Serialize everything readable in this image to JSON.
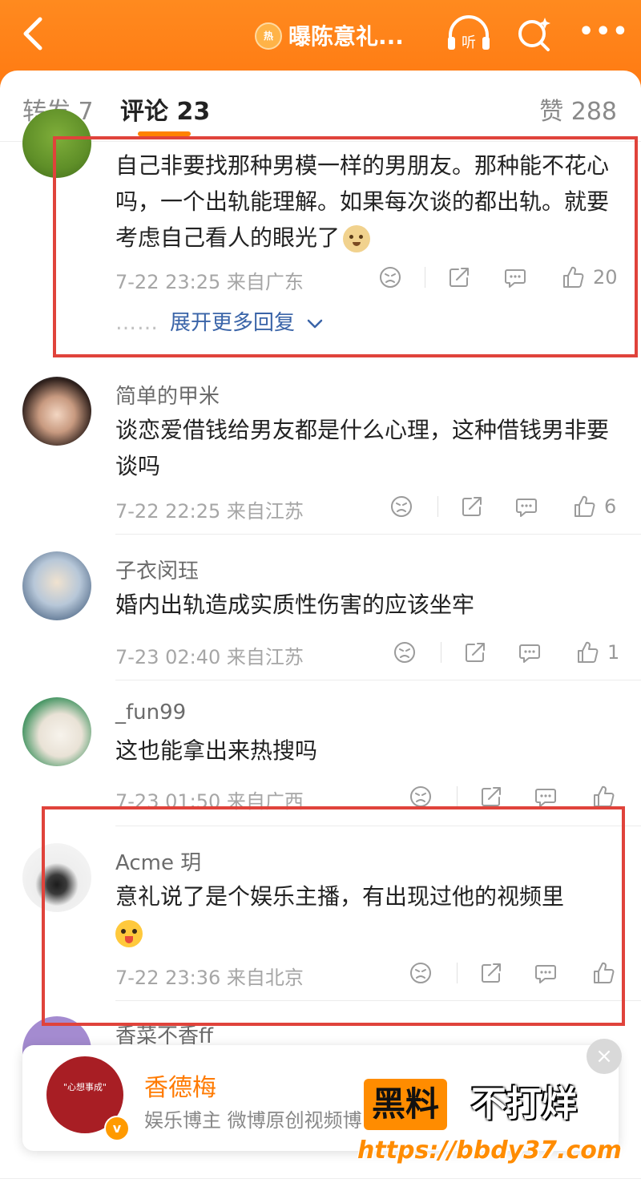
{
  "header": {
    "back_icon": "chevron-left-icon",
    "hot_badge": "热",
    "title": "曝陈意礼...",
    "listen_label": "听",
    "more_label": "•••"
  },
  "tabs": {
    "repost": "转发 7",
    "comment": "评论 23",
    "likes": "赞 288"
  },
  "comments": [
    {
      "username": "",
      "text": "自己非要找那种男模一样的男朋友。那种能不花心吗，一个出轨能理解。如果每次谈的都出轨。就要考虑自己看人的眼光了",
      "emoji": "doge-emoji",
      "meta": "7-22 23:25 来自广东",
      "likes": "20",
      "expand": "展开更多回复",
      "expand_dots": "……"
    },
    {
      "username": "简单的甲米",
      "text": "谈恋爱借钱给男友都是什么心理，这种借钱男非要谈吗",
      "meta": "7-22 22:25 来自江苏",
      "likes": "6"
    },
    {
      "username": "子衣闵珏",
      "text": "婚内出轨造成实质性伤害的应该坐牢",
      "meta": "7-23 02:40 来自江苏",
      "likes": "1"
    },
    {
      "username": "_fun99",
      "text": "这也能拿出来热搜吗",
      "meta": "7-23 01:50 来自广西",
      "likes": ""
    },
    {
      "username": "Acme 玥",
      "text": "意礼说了是个娱乐主播，有出现过他的视频里",
      "emoji": "tongue-emoji",
      "meta": "7-22 23:36 来自北京",
      "likes": ""
    }
  ],
  "partial_comment": {
    "username": "香菜不香ff"
  },
  "card": {
    "name": "香德梅",
    "description": "娱乐博主 微博原创视频博",
    "avatar_text": "\"心想事成\"",
    "close_label": "×",
    "verified_badge": "v"
  },
  "watermark": {
    "part1": "黑料",
    "part2": "不打烊",
    "url": "https://bbdy37.com"
  },
  "colors": {
    "header_orange": "#ff7a12",
    "tab_underline": "#ff8200",
    "highlight_box": "#e0433b",
    "link_blue": "#3a64a8"
  }
}
